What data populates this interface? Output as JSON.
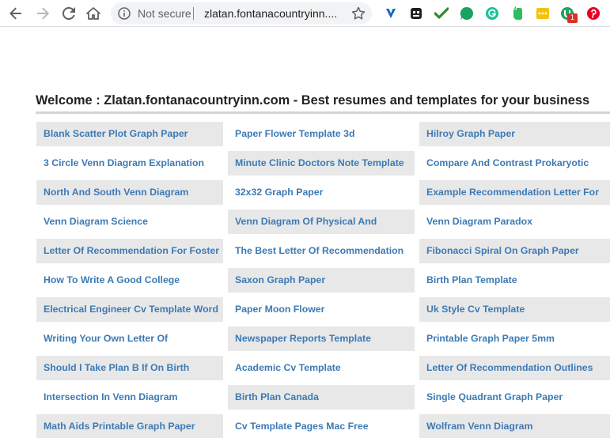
{
  "browser": {
    "security_text": "Not secure",
    "url": "zlatan.fontanacountryinn....",
    "extension_badge": "1",
    "icons": [
      "back-arrow-icon",
      "forward-arrow-icon",
      "reload-icon",
      "home-icon",
      "info-icon",
      "bookmark-star-icon",
      "v-extension-icon",
      "dark-square-extension-icon",
      "checkmark-extension-icon",
      "green-circle-extension-icon",
      "grammarly-icon",
      "evernote-icon",
      "yellow-extension-icon",
      "green-u-extension-icon",
      "pinterest-icon"
    ]
  },
  "page": {
    "heading": "Welcome : Zlatan.fontanacountryinn.com - Best resumes and templates for your business",
    "link_color": "#3d7ab5",
    "shade_color": "#e8e8e8",
    "links": [
      [
        "Blank Scatter Plot Graph Paper",
        "Paper Flower Template 3d",
        "Hilroy Graph Paper"
      ],
      [
        "3 Circle Venn Diagram Explanation",
        "Minute Clinic Doctors Note Template",
        "Compare And Contrast Prokaryotic"
      ],
      [
        "North And South Venn Diagram",
        "32x32 Graph Paper",
        "Example Recommendation Letter For"
      ],
      [
        "Venn Diagram Science",
        "Venn Diagram Of Physical And",
        "Venn Diagram Paradox"
      ],
      [
        "Letter Of Recommendation For Foster",
        "The Best Letter Of Recommendation",
        "Fibonacci Spiral On Graph Paper"
      ],
      [
        "How To Write A Good College",
        "Saxon Graph Paper",
        "Birth Plan Template"
      ],
      [
        "Electrical Engineer Cv Template Word",
        "Paper Moon Flower",
        "Uk Style Cv Template"
      ],
      [
        "Writing Your Own Letter Of",
        "Newspaper Reports Template",
        "Printable Graph Paper 5mm"
      ],
      [
        "Should I Take Plan B If On Birth",
        "Academic Cv Template",
        "Letter Of Recommendation Outlines"
      ],
      [
        "Intersection In Venn Diagram",
        "Birth Plan Canada",
        "Single Quadrant Graph Paper"
      ],
      [
        "Math Aids Printable Graph Paper",
        "Cv Template Pages Mac Free",
        "Wolfram Venn Diagram"
      ]
    ]
  }
}
